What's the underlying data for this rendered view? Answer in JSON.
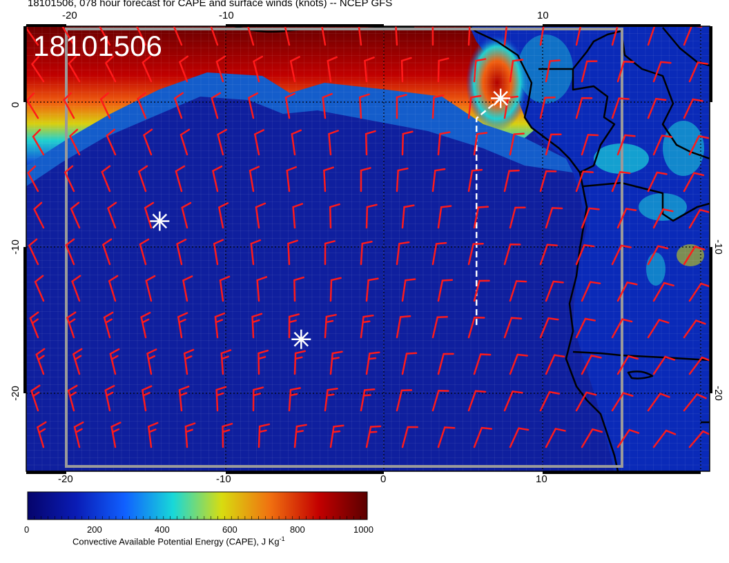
{
  "title": "18101506, 078 hour forecast for CAPE and surface winds (knots) -- NCEP GFS",
  "stamp": "18101506",
  "map": {
    "lon_range": [
      -23,
      19.5
    ],
    "lat_range": [
      -24,
      5
    ],
    "x_ticks_top": [
      "-20",
      "-10",
      "10"
    ],
    "x_ticks_bottom": [
      "-20",
      "-10",
      "0",
      "10"
    ],
    "y_ticks_left": [
      "0",
      "-10",
      "-20"
    ],
    "y_ticks_right": [
      "-10",
      "-20"
    ],
    "markers": [
      {
        "lon": 6.5,
        "lat": 0.3
      },
      {
        "lon": -14.7,
        "lat": -7.7
      },
      {
        "lon": -5.9,
        "lat": -15.4
      }
    ],
    "track": [
      [
        6.5,
        0.3
      ],
      [
        5,
        -1
      ],
      [
        5,
        -14.5
      ]
    ],
    "colors": {
      "ocean": "#0f1f9e",
      "barb": "#ff1a1a",
      "marker": "#ffffff",
      "coast": "#000000",
      "gridline": "#9a9a9a"
    }
  },
  "colorbar": {
    "ticks": [
      "0",
      "200",
      "400",
      "600",
      "800",
      "1000"
    ],
    "title": "Convective Available Potential Energy (CAPE), J Kg",
    "title_superscript": "-1",
    "stops": [
      "#05046b",
      "#0a1cb5",
      "#1060ff",
      "#18d8d8",
      "#d8dc10",
      "#f07010",
      "#c30000",
      "#5a0000"
    ]
  }
}
